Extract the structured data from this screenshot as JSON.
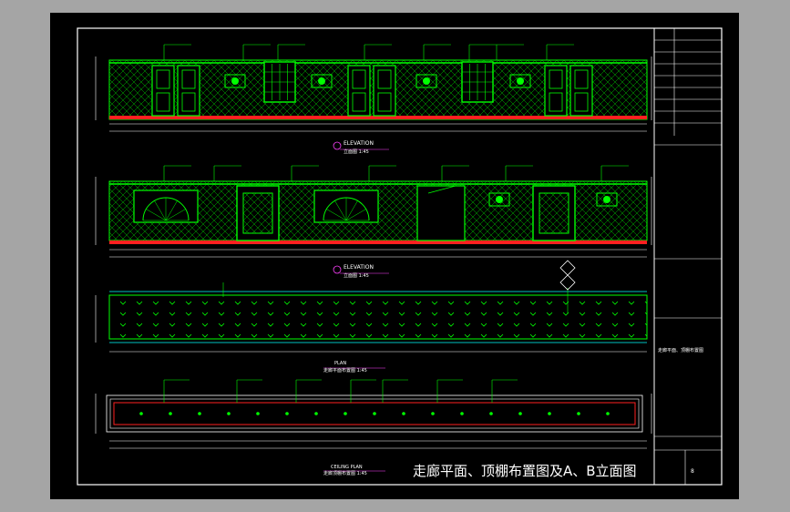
{
  "title": "走廊平面、顶棚布置图及A、B立面图",
  "elevation_a": {
    "label": "ELEVATION",
    "sub": "立面图 1:45"
  },
  "elevation_b": {
    "label": "ELEVATION",
    "sub": "立面图 1:45"
  },
  "plan": {
    "label": "PLAN",
    "sub": "走廊平面布置图 1:45"
  },
  "ceiling": {
    "label": "CEILING PLAN",
    "sub": "走廊顶棚布置图 1:45"
  },
  "titleblock": {
    "drawing_no": "8",
    "sheet_label": "走廊平面、顶棚布置图"
  },
  "colors": {
    "background": "#000000",
    "frame": "#ffffff",
    "lines": "#00ff00",
    "red": "#ff2020",
    "accent": "#00ffff"
  }
}
